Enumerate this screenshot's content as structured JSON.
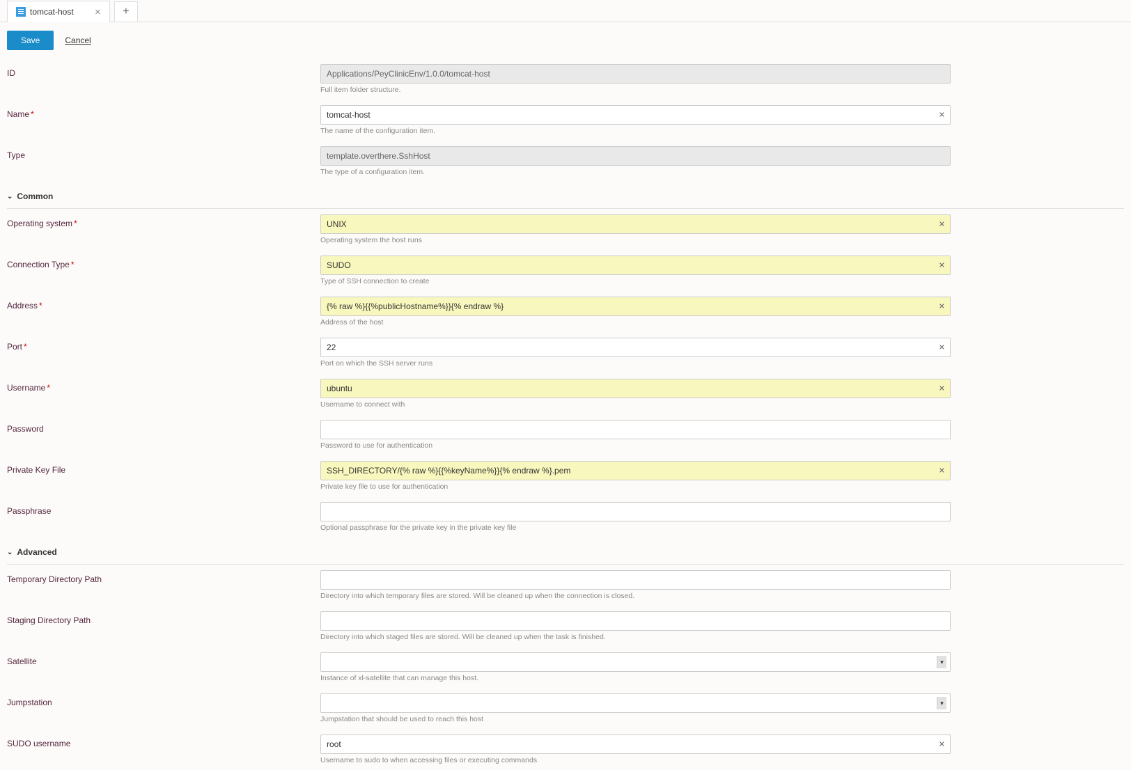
{
  "tabs": {
    "active_title": "tomcat-host",
    "add_icon_title": "Add tab"
  },
  "actions": {
    "save": "Save",
    "cancel": "Cancel"
  },
  "fields": {
    "id": {
      "label": "ID",
      "value": "Applications/PeyClinicEnv/1.0.0/tomcat-host",
      "hint": "Full item folder structure."
    },
    "name": {
      "label": "Name",
      "value": "tomcat-host",
      "hint": "The name of the configuration item."
    },
    "type": {
      "label": "Type",
      "value": "template.overthere.SshHost",
      "hint": "The type of a configuration item."
    }
  },
  "sections": {
    "common": {
      "title": "Common",
      "os": {
        "label": "Operating system",
        "value": "UNIX",
        "hint": "Operating system the host runs"
      },
      "conn": {
        "label": "Connection Type",
        "value": "SUDO",
        "hint": "Type of SSH connection to create"
      },
      "address": {
        "label": "Address",
        "value": "{% raw %}{{%publicHostname%}}{% endraw %}",
        "hint": "Address of the host"
      },
      "port": {
        "label": "Port",
        "value": "22",
        "hint": "Port on which the SSH server runs"
      },
      "username": {
        "label": "Username",
        "value": "ubuntu",
        "hint": "Username to connect with"
      },
      "password": {
        "label": "Password",
        "value": "",
        "hint": "Password to use for authentication"
      },
      "pkey": {
        "label": "Private Key File",
        "value": "SSH_DIRECTORY/{% raw %}{{%keyName%}}{% endraw %}.pem",
        "hint": "Private key file to use for authentication"
      },
      "passphrase": {
        "label": "Passphrase",
        "value": "",
        "hint": "Optional passphrase for the private key in the private key file"
      }
    },
    "advanced": {
      "title": "Advanced",
      "tmp": {
        "label": "Temporary Directory Path",
        "value": "",
        "hint": "Directory into which temporary files are stored. Will be cleaned up when the connection is closed."
      },
      "staging": {
        "label": "Staging Directory Path",
        "value": "",
        "hint": "Directory into which staged files are stored. Will be cleaned up when the task is finished."
      },
      "satellite": {
        "label": "Satellite",
        "value": "",
        "hint": "Instance of xl-satellite that can manage this host."
      },
      "jump": {
        "label": "Jumpstation",
        "value": "",
        "hint": "Jumpstation that should be used to reach this host"
      },
      "sudo": {
        "label": "SUDO username",
        "value": "root",
        "hint": "Username to sudo to when accessing files or executing commands"
      }
    }
  }
}
